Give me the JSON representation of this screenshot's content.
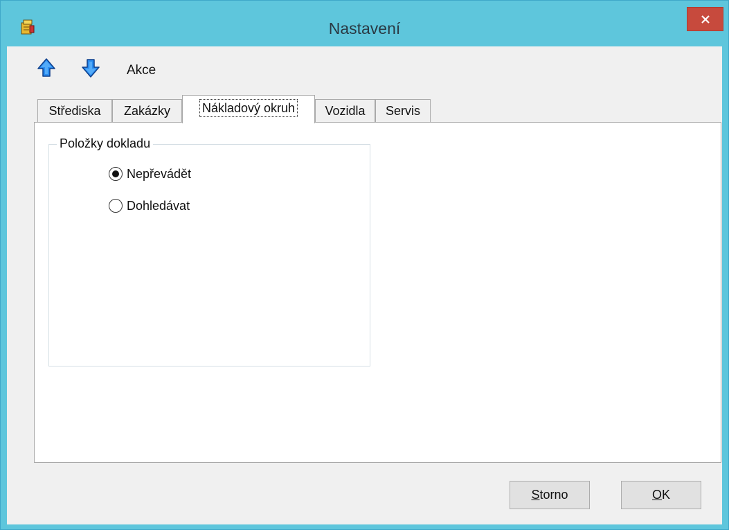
{
  "window": {
    "title": "Nastavení",
    "close_label": "×"
  },
  "toolbar": {
    "up_icon": "arrow-up-icon",
    "down_icon": "arrow-down-icon",
    "akce_label": "Akce"
  },
  "tabs": [
    {
      "label": "Střediska",
      "active": false
    },
    {
      "label": "Zakázky",
      "active": false
    },
    {
      "label": "Nákladový okruh",
      "active": true
    },
    {
      "label": "Vozidla",
      "active": false
    },
    {
      "label": "Servis",
      "active": false
    }
  ],
  "group": {
    "label": "Položky dokladu",
    "options": [
      {
        "label": "Nepřevádět",
        "checked": true
      },
      {
        "label": "Dohledávat",
        "checked": false
      }
    ]
  },
  "buttons": {
    "storno_mnemonic": "S",
    "storno_rest": "torno",
    "ok_mnemonic": "O",
    "ok_rest": "K"
  },
  "colors": {
    "titlebar": "#5ec6dc",
    "close": "#c74a3d",
    "arrow": "#1e6fd8"
  }
}
